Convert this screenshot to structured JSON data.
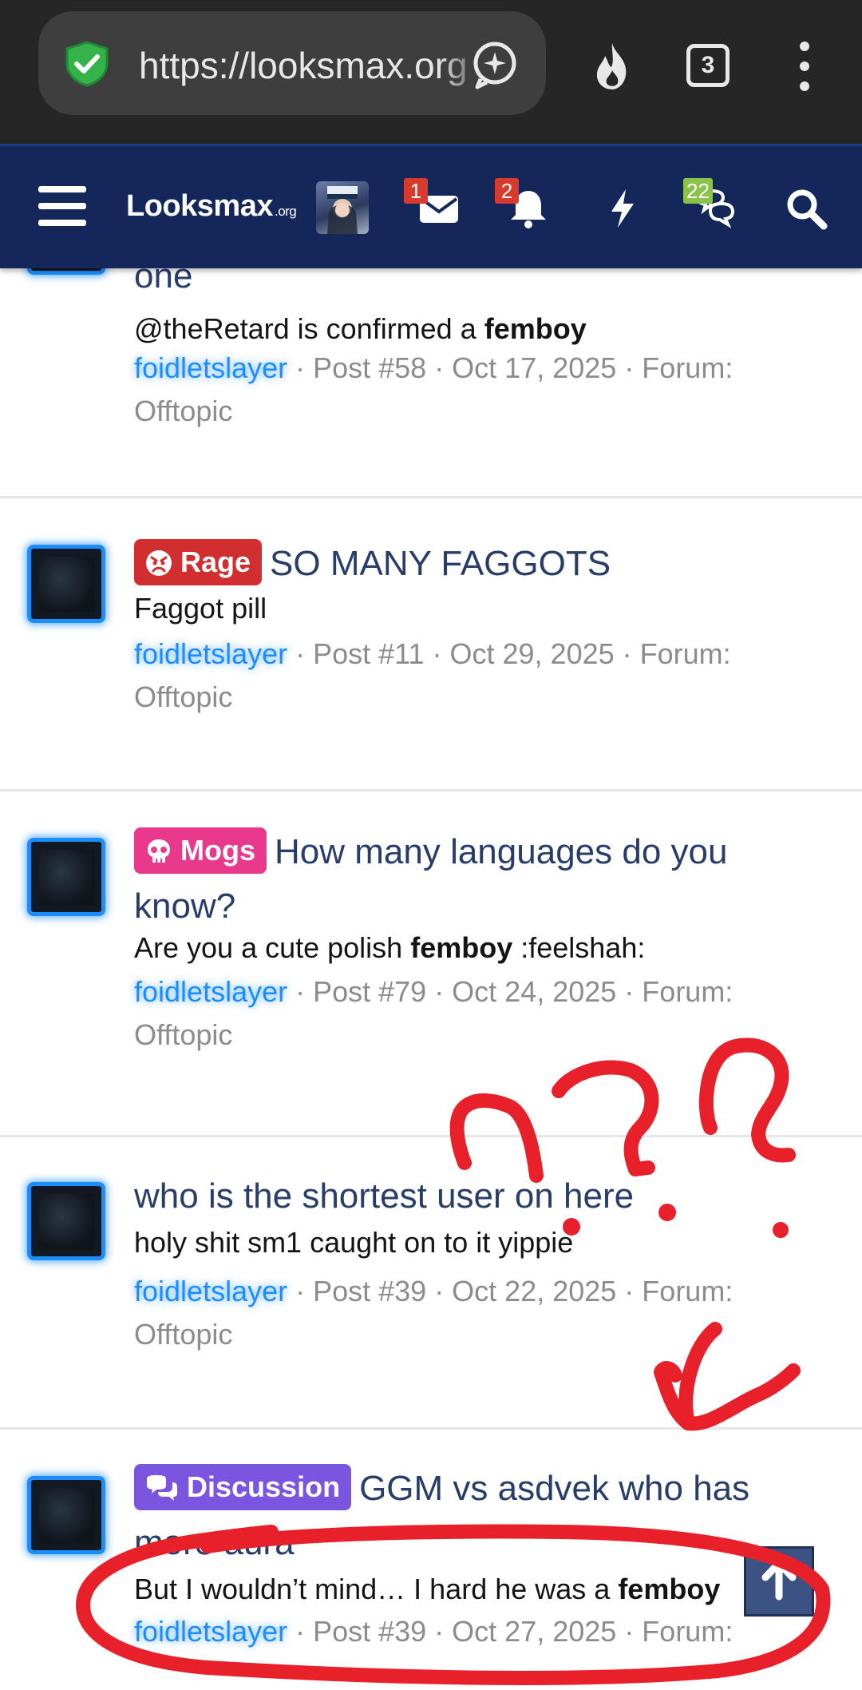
{
  "browser": {
    "url": "https://looksmax.org",
    "tab_count": "3"
  },
  "nav": {
    "logo_main": "Looksmax",
    "logo_suffix": ".org",
    "badges": {
      "messages": "1",
      "alerts": "2",
      "conversations": "22"
    }
  },
  "results": [
    {
      "title": "one",
      "snippet_pre": "@theRetard is confirmed a ",
      "snippet_bold": "femboy",
      "snippet_post": "",
      "user": "foidletslayer",
      "meta": " · Post #58 · Oct 17, 2025 · Forum: Offtopic"
    },
    {
      "prefix": "Rage",
      "prefix_color": "#d12f2f",
      "prefix_icon": "angry-face-icon",
      "title": "SO MANY FAGGOTS",
      "snippet_pre": "Faggot pill",
      "snippet_bold": "",
      "snippet_post": "",
      "user": "foidletslayer",
      "meta": " · Post #11 · Oct 29, 2025 · Forum: Offtopic"
    },
    {
      "prefix": "Mogs",
      "prefix_color": "#e8398d",
      "prefix_icon": "skull-icon",
      "title": "How many languages do you know?",
      "snippet_pre": "Are you a cute polish ",
      "snippet_bold": "femboy",
      "snippet_post": " :feelshah:",
      "user": "foidletslayer",
      "meta": " · Post #79 · Oct 24, 2025 · Forum: Offtopic"
    },
    {
      "title": "who is the shortest user on here",
      "snippet_pre": "holy shit sm1 caught on to it yippie",
      "snippet_bold": "",
      "snippet_post": "",
      "user": "foidletslayer",
      "meta": " · Post #39 · Oct 22, 2025 · Forum: Offtopic"
    },
    {
      "prefix": "Discussion",
      "prefix_color": "#7b55e0",
      "prefix_icon": "chat-bubbles-icon",
      "title": "GGM vs asdvek who has more aura",
      "snippet_pre": "But I wouldn’t mind… I hard he was a ",
      "snippet_bold": "femboy",
      "snippet_post": "",
      "user": "foidletslayer",
      "meta": " · Post #39 · Oct 27, 2025 · Forum:"
    }
  ],
  "colors": {
    "nav_bg": "#13275b",
    "title": "#283d6a",
    "username_glow": "#1c8dff",
    "scribble": "#e8202a"
  }
}
